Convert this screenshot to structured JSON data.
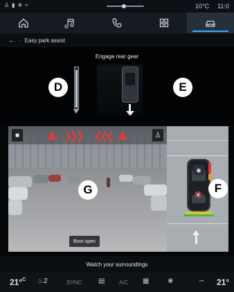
{
  "status_bar": {
    "temperature": "10°C",
    "time": "11:0"
  },
  "nav": {
    "items": [
      {
        "icon": "home-icon"
      },
      {
        "icon": "music-icon"
      },
      {
        "icon": "phone-icon"
      },
      {
        "icon": "apps-icon"
      },
      {
        "icon": "car-icon",
        "active": true
      }
    ]
  },
  "breadcrumb": {
    "title": "Easy park assist"
  },
  "guidance": {
    "instruction": "Engage rear gear"
  },
  "callouts": {
    "d": "D",
    "e": "E",
    "f": "F",
    "g": "G"
  },
  "camera": {
    "boot_status": "Boot open"
  },
  "message": {
    "text": "Watch your surroundings"
  },
  "climate": {
    "left_temp": "21°",
    "left_temp_unit": "C",
    "seat_level": "2",
    "sync": "SYNC",
    "ac": "A/C",
    "right_temp": "21°"
  },
  "colors": {
    "warning": "#e23b3b",
    "accent": "#3fa7ff"
  }
}
